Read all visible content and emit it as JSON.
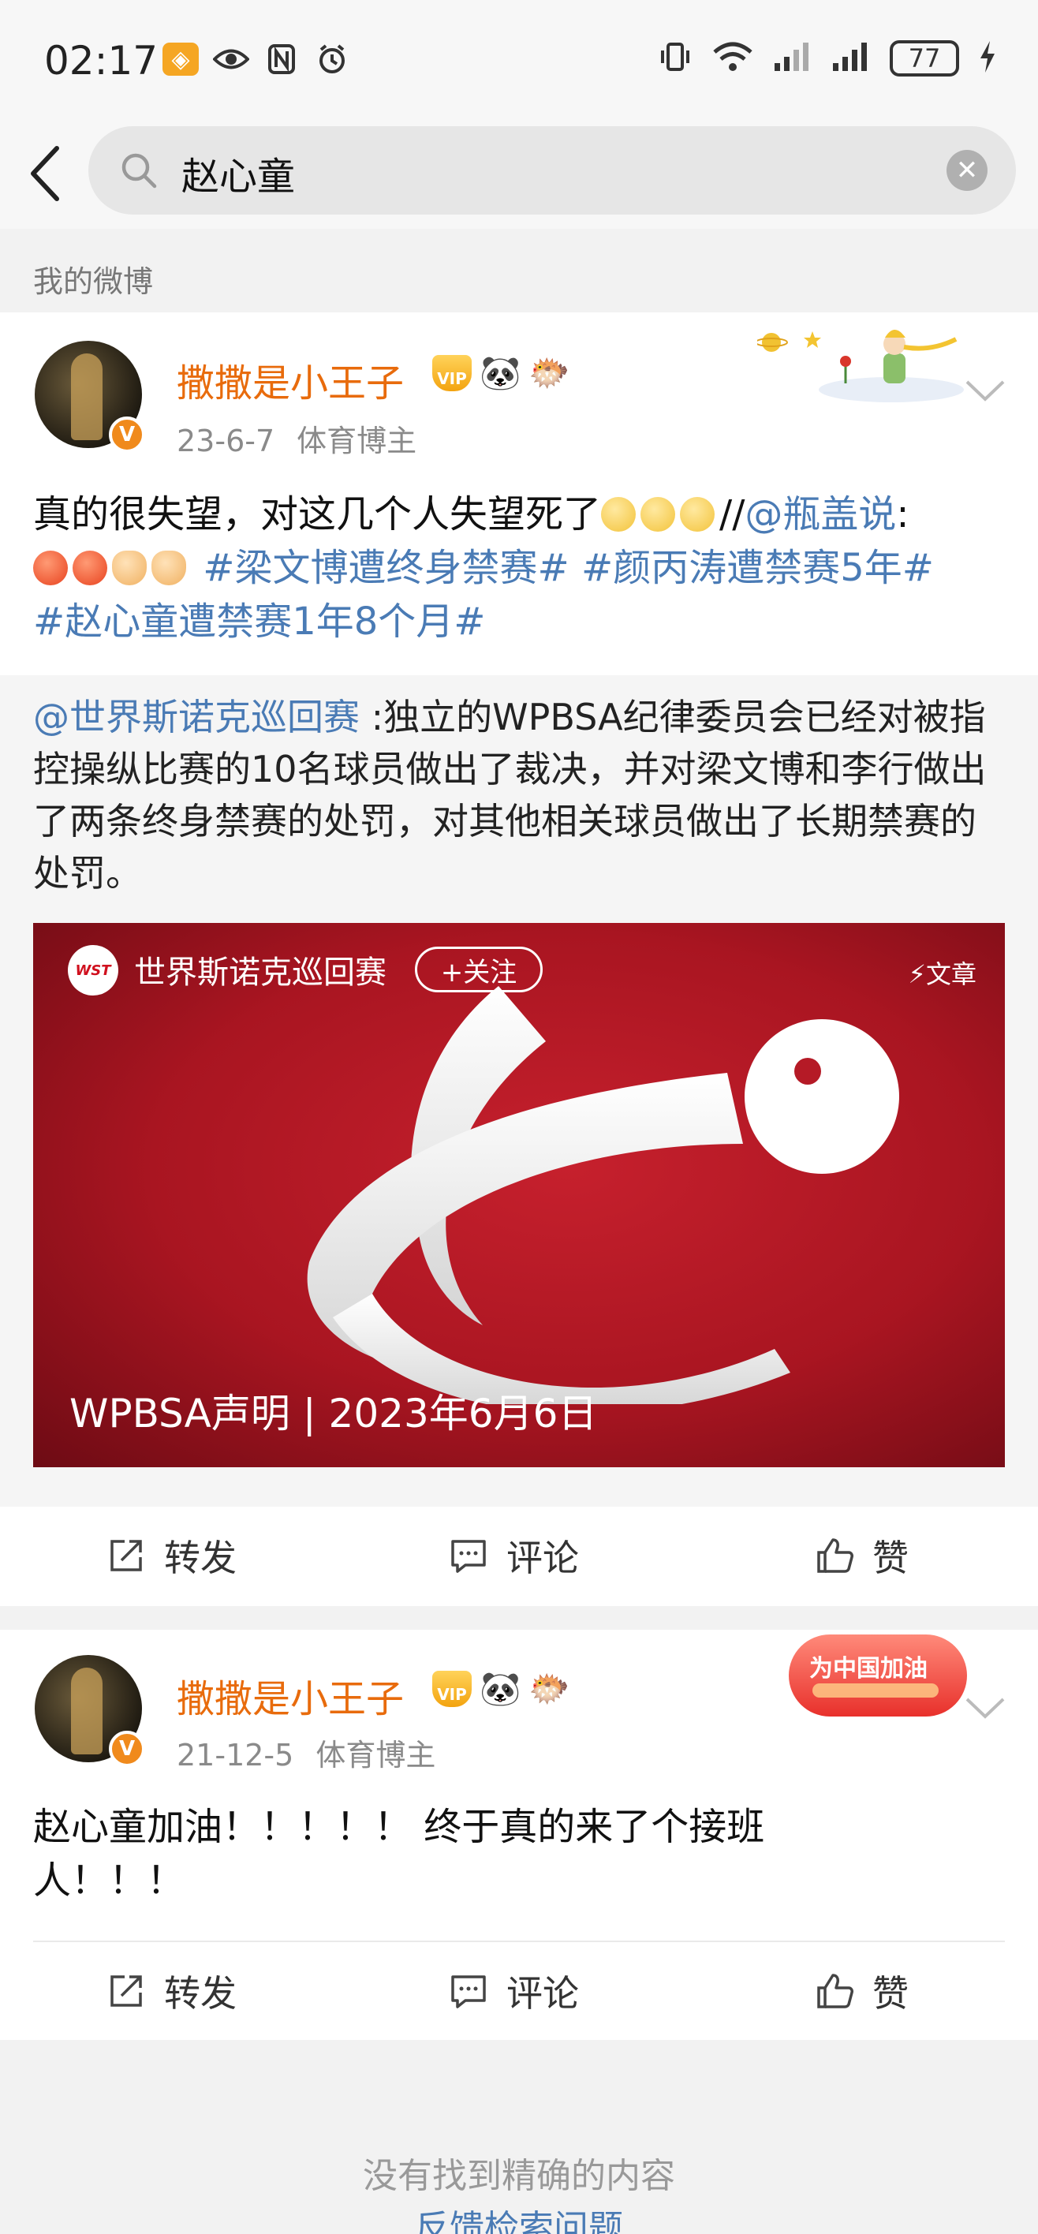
{
  "status_bar": {
    "time": "02:17",
    "battery": "77"
  },
  "search": {
    "query": "赵心童"
  },
  "section_label": "我的微博",
  "posts": [
    {
      "username": "撒撒是小王子",
      "date": "23-6-7",
      "source": "体育博主",
      "text_1": "真的很失望，对这几个人失望死了",
      "text_sep": "//",
      "mention": "@瓶盖说",
      "mention_suffix": ":",
      "tag_1": "#梁文博遭终身禁赛#",
      "tag_2": "#颜丙涛遭禁赛5年#",
      "tag_3": "#赵心童遭禁赛1年8个月#",
      "repost": {
        "author": "@世界斯诺克巡回赛",
        "text": " :独立的WPBSA纪律委员会已经对被指控操纵比赛的10名球员做出了裁决，并对梁文博和李行做出了两条终身禁赛的处罚，对其他相关球员做出了长期禁赛的处罚。",
        "article": {
          "logo_text": "WST",
          "account": "世界斯诺克巡回赛",
          "follow": "+关注",
          "tag": "⚡文章",
          "title": "WPBSA声明 | 2023年6月6日"
        }
      },
      "actions": {
        "repost": "转发",
        "comment": "评论",
        "like": "赞"
      }
    },
    {
      "username": "撒撒是小王子",
      "date": "21-12-5",
      "source": "体育博主",
      "decor_text": "为中国加油",
      "text_line1": "赵心童加油！！！！！ 终于真的来了个接班",
      "text_line2": "人！！！",
      "actions": {
        "repost": "转发",
        "comment": "评论",
        "like": "赞"
      }
    }
  ],
  "empty_state": {
    "message": "没有找到精确的内容",
    "feedback_link": "反馈检索问题"
  },
  "colors": {
    "username": "#e86b0c",
    "link": "#4a7bb5",
    "article_bg": "#a91521"
  },
  "icons": [
    "back-arrow-icon",
    "search-icon",
    "clear-icon",
    "chevron-down-icon",
    "repost-icon",
    "comment-icon",
    "like-icon",
    "vip-icon",
    "panda-icon",
    "pufferfish-icon",
    "verified-icon"
  ]
}
